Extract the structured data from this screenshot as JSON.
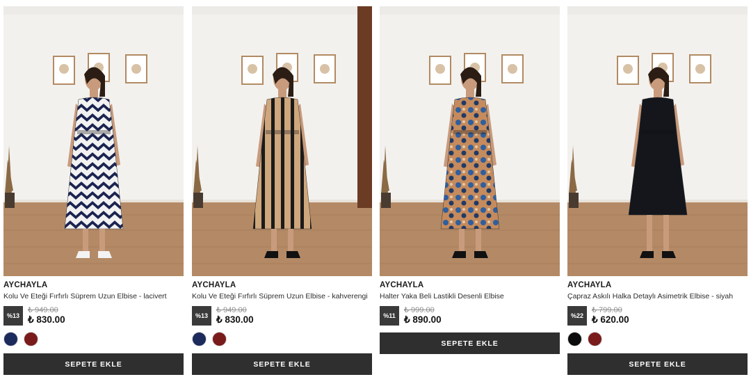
{
  "products": [
    {
      "brand": "AYCHAYLA",
      "title": "Kolu Ve Eteği Fırfırlı Süprem Uzun Elbise - lacivert",
      "discount": "%13",
      "old_price": "₺ 949.00",
      "new_price": "₺ 830.00",
      "swatches": [
        "#1d2a5c",
        "#7a1b1b"
      ],
      "cart_label": "SEPETE EKLE",
      "dress": "navy-chevron"
    },
    {
      "brand": "AYCHAYLA",
      "title": "Kolu Ve Eteği Fırfırlı Süprem Uzun Elbise - kahverengi",
      "discount": "%13",
      "old_price": "₺ 949.00",
      "new_price": "₺ 830.00",
      "swatches": [
        "#1d2a5c",
        "#7a1b1b"
      ],
      "cart_label": "SEPETE EKLE",
      "dress": "brown-stripe"
    },
    {
      "brand": "AYCHAYLA",
      "title": "Halter Yaka Beli Lastikli Desenli Elbise",
      "discount": "%11",
      "old_price": "₺ 999.00",
      "new_price": "₺ 890.00",
      "swatches": [],
      "cart_label": "SEPETE EKLE",
      "dress": "paisley"
    },
    {
      "brand": "AYCHAYLA",
      "title": "Çapraz Askılı Halka Detaylı Asimetrik Elbise - siyah",
      "discount": "%22",
      "old_price": "₺ 799.00",
      "new_price": "₺ 620.00",
      "swatches": [
        "#0c0c0c",
        "#7a1b1b"
      ],
      "cart_label": "SEPETE EKLE",
      "dress": "black"
    }
  ]
}
